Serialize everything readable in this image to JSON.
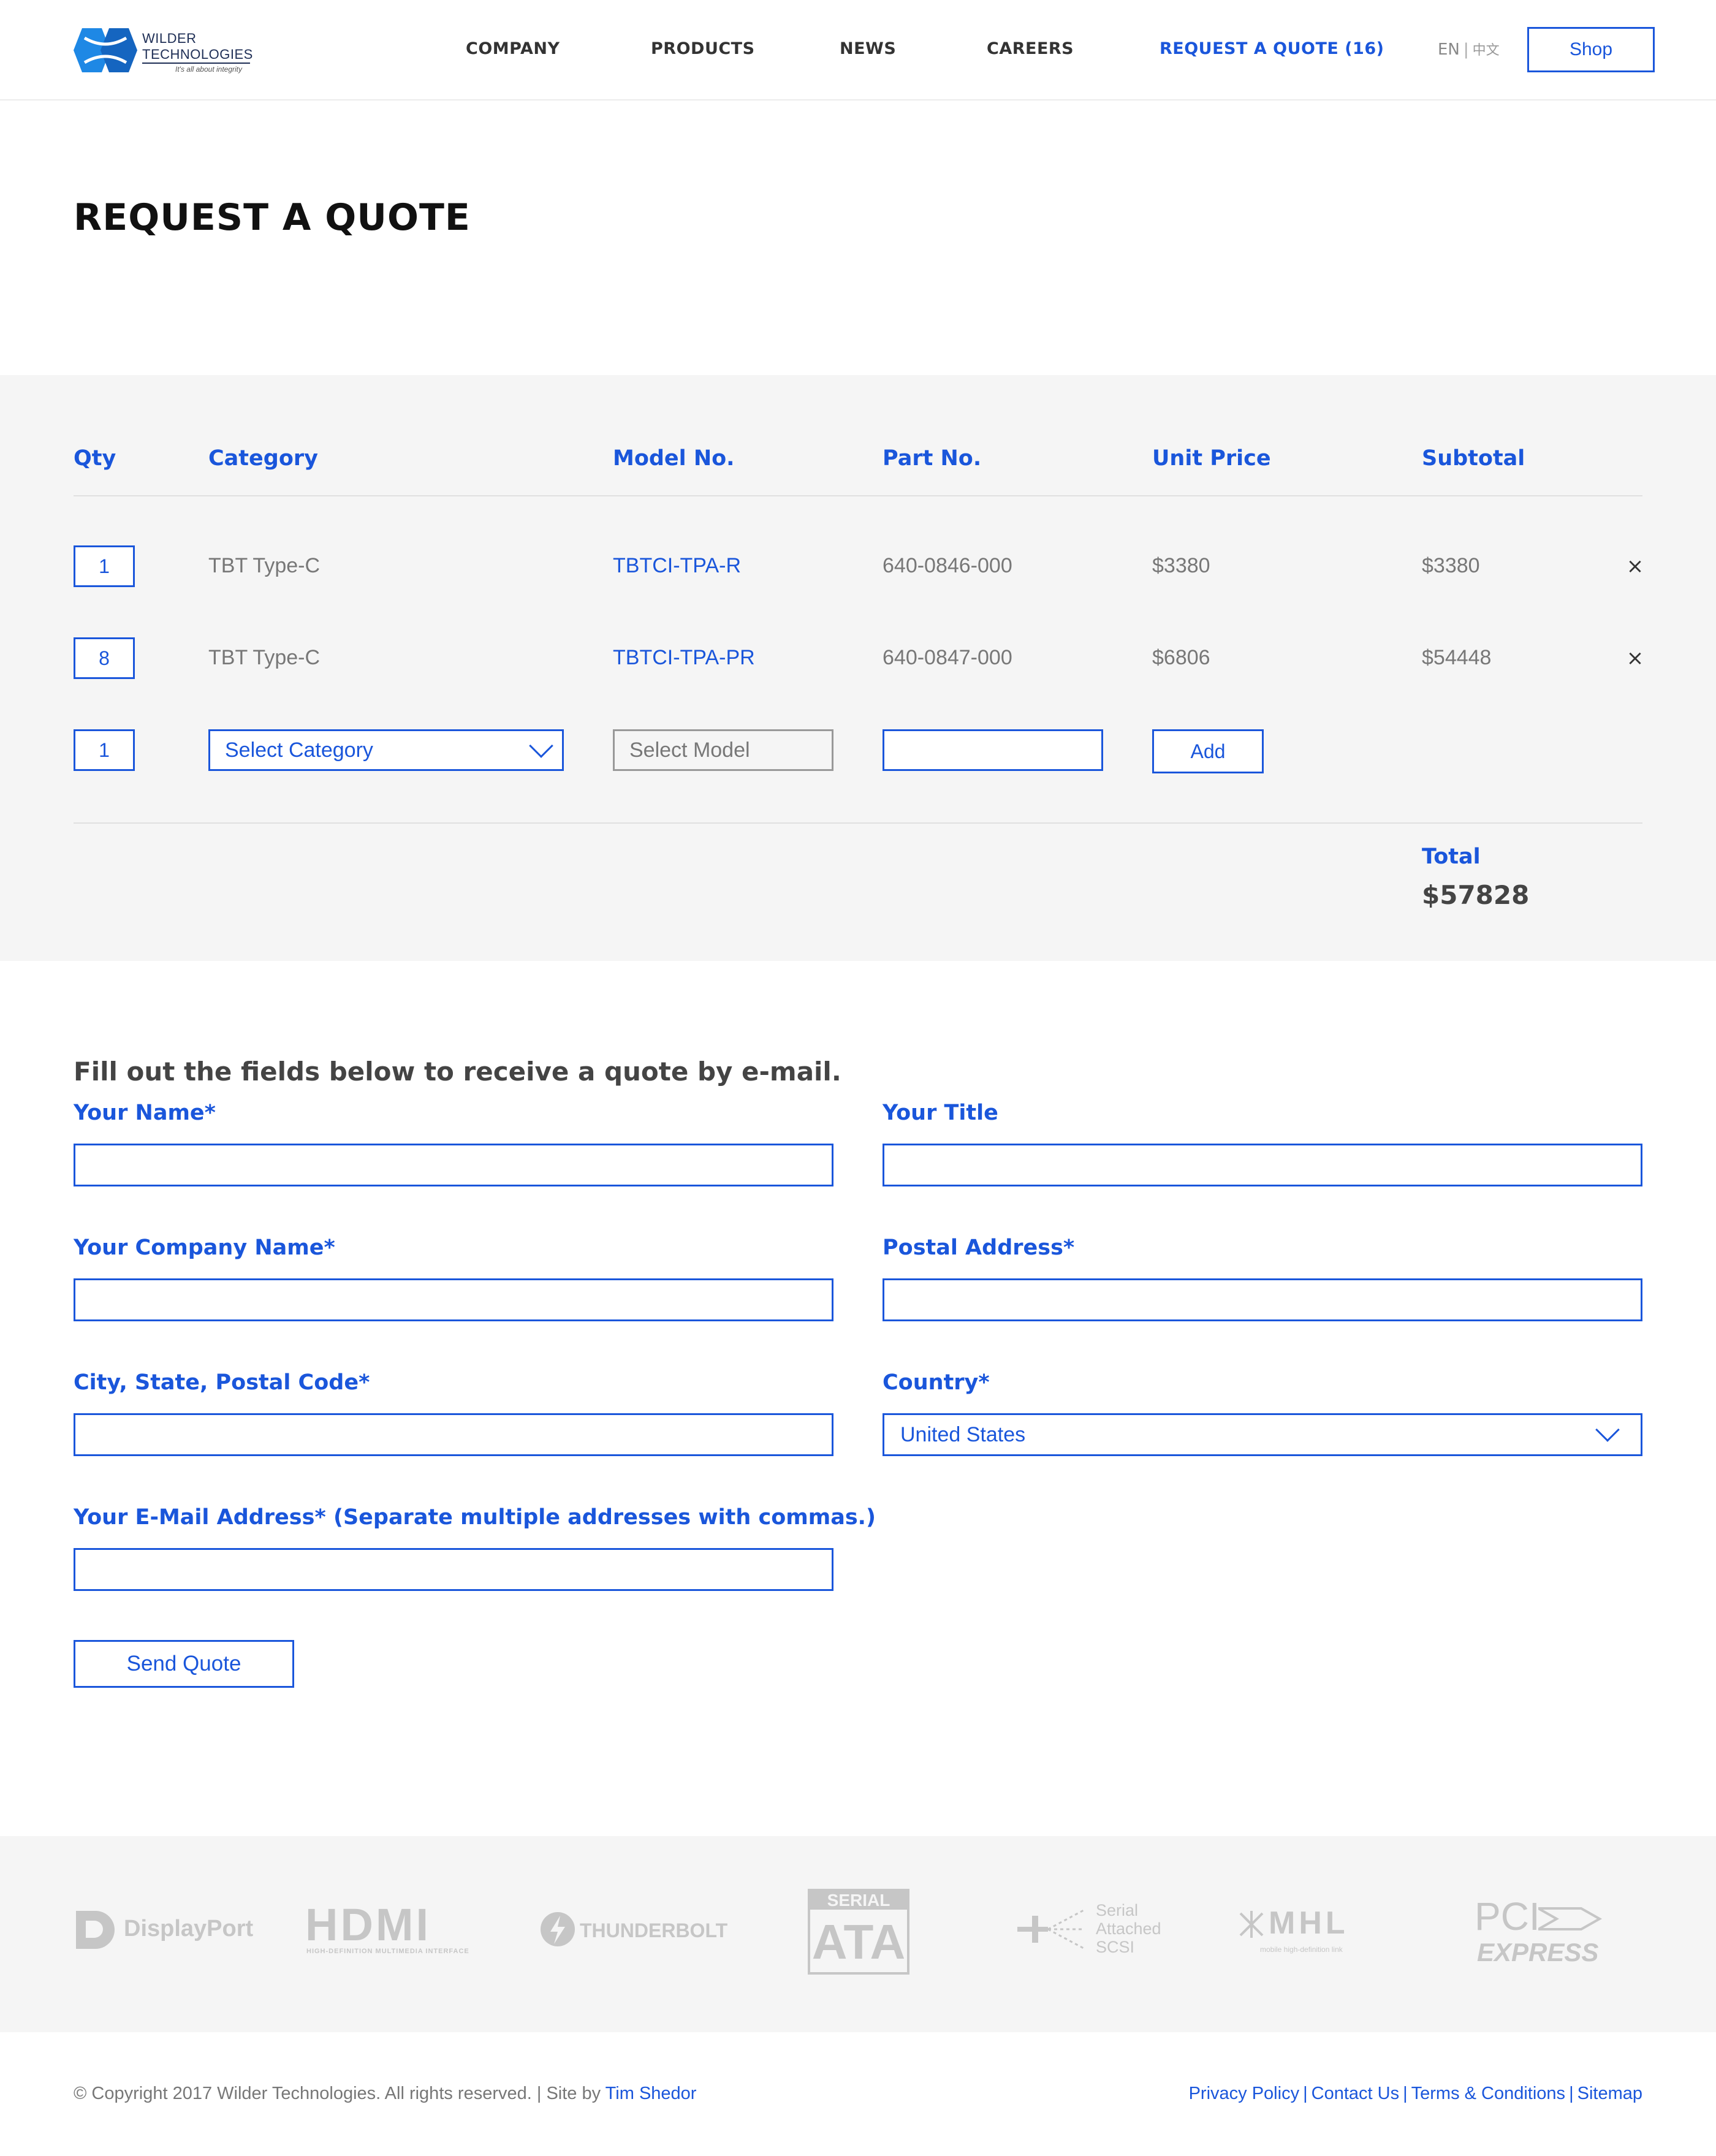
{
  "header": {
    "logo": {
      "line1": "WILDER",
      "line2": "TECHNOLOGIES",
      "tagline": "It's all about integrity",
      "color": "#1e88e5"
    },
    "nav": [
      {
        "label": "COMPANY"
      },
      {
        "label": "PRODUCTS"
      },
      {
        "label": "NEWS"
      },
      {
        "label": "CAREERS"
      },
      {
        "label": "REQUEST A QUOTE (16)"
      }
    ],
    "lang": {
      "en": "EN",
      "sep": "|",
      "zh": "中文"
    },
    "shop_label": "Shop"
  },
  "page_title": "REQUEST A QUOTE",
  "cart": {
    "columns": [
      "Qty",
      "Category",
      "Model No.",
      "Part No.",
      "Unit Price",
      "Subtotal"
    ],
    "rows": [
      {
        "qty": "1",
        "category": "TBT Type-C",
        "model": "TBTCI-TPA-R",
        "part": "640-0846-000",
        "unit_price": "$3380",
        "subtotal": "$3380"
      },
      {
        "qty": "8",
        "category": "TBT Type-C",
        "model": "TBTCI-TPA-PR",
        "part": "640-0847-000",
        "unit_price": "$6806",
        "subtotal": "$54448"
      }
    ],
    "new_row": {
      "qty": "1",
      "category_placeholder": "Select Category",
      "model_placeholder": "Select Model",
      "part_value": "",
      "add_label": "Add"
    },
    "remove_glyph": "×",
    "total_label": "Total",
    "total_value": "$57828"
  },
  "form": {
    "intro": "Fill out the fields below to receive a quote by e-mail.",
    "name_label": "Your Name*",
    "title_label": "Your Title",
    "company_label": "Your Company Name*",
    "postal_label": "Postal Address*",
    "city_label": "City, State, Postal Code*",
    "country_label": "Country*",
    "country_value": "United States",
    "email_label": "Your E-Mail Address* (Separate multiple addresses with commas.)",
    "send_label": "Send Quote"
  },
  "partner_logos": {
    "displayport": "DisplayPort",
    "hdmi": "HDMI",
    "hdmi_sub": "HIGH-DEFINITION MULTIMEDIA INTERFACE",
    "thunderbolt": "THUNDERBOLT",
    "sata_top": "SERIAL",
    "sata_main": "ATA",
    "sas_line1": "Serial",
    "sas_line2": "Attached",
    "sas_line3": "SCSI",
    "mhl": "MHL",
    "mhl_sub": "mobile high-definition link",
    "pci": "PCI",
    "pci_express": "EXPRESS"
  },
  "footer": {
    "copyright": "© Copyright 2017 Wilder Technologies. All rights reserved. | Site by ",
    "site_by": "Tim Shedor",
    "links": [
      "Privacy Policy",
      "Contact Us",
      "Terms & Conditions",
      "Sitemap"
    ],
    "sep": "|"
  },
  "colors": {
    "accent": "#1a56db",
    "band": "#f5f5f5",
    "text": "#333333"
  }
}
